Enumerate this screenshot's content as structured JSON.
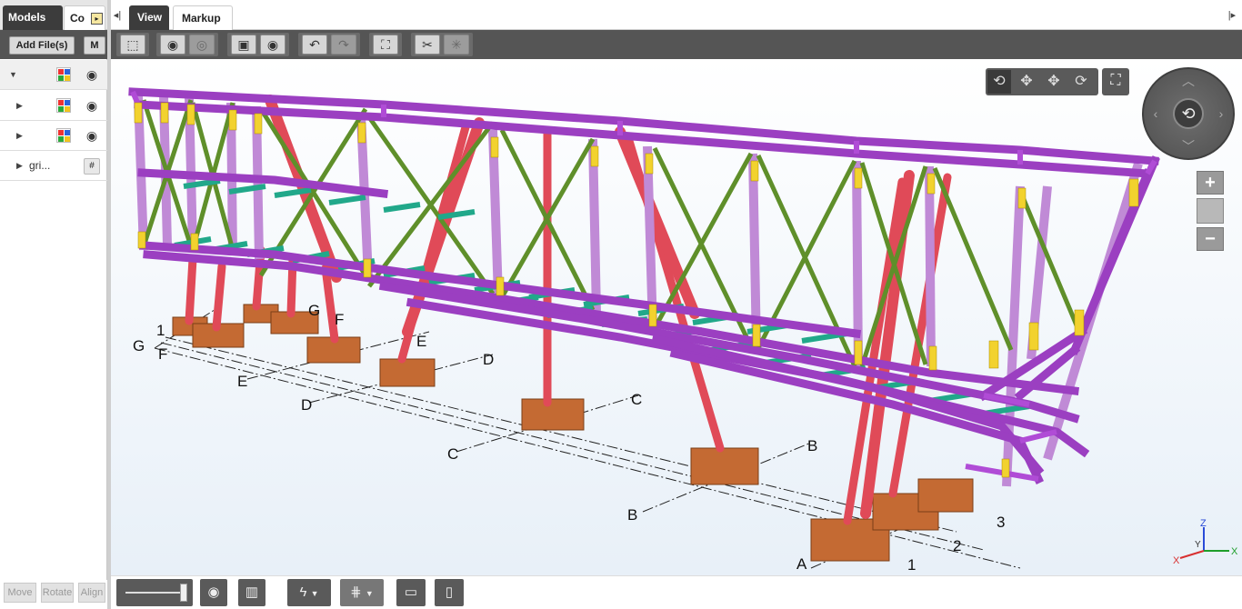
{
  "left_panel": {
    "tabs": [
      "Models",
      "Co"
    ],
    "add_files_label": "Add File(s)",
    "m_label": "M",
    "tree": [
      {
        "label": "",
        "expanded": true
      },
      {
        "label": "",
        "expanded": false
      },
      {
        "label": "",
        "expanded": false
      },
      {
        "label": "gri...",
        "expanded": false
      }
    ],
    "bottom_buttons": [
      "Move",
      "Rotate",
      "Align"
    ]
  },
  "top_tabs": {
    "view": "View",
    "markup": "Markup"
  },
  "toolbar": {
    "buttons": [
      "select-box",
      "visibility-toggle",
      "isolate",
      "snapshot",
      "object-view",
      "undo",
      "redo",
      "fit-view",
      "cut-plane",
      "section-tools"
    ]
  },
  "viewport": {
    "grid_labels": [
      "G",
      "F",
      "E",
      "D",
      "C",
      "B",
      "A",
      "1",
      "2",
      "3"
    ],
    "grid_text": {
      "G_left": "G",
      "F_left": "F",
      "E_left": "E",
      "D_left": "D",
      "C_left": "C",
      "B_left": "B",
      "A_bottom": "A",
      "one_left": "1",
      "G_top": "G",
      "F_top": "F",
      "E_top": "E",
      "D_top": "D",
      "C_top": "C",
      "B_top": "B",
      "one_right": "1",
      "two_right": "2",
      "three_right": "3"
    },
    "axis_triad": {
      "x": "X",
      "y": "Y",
      "z": "Z"
    },
    "colors": {
      "purple_beam": "#9b3fc1",
      "lilac_column": "#c08ad6",
      "red_member": "#e04a58",
      "green_brace": "#5f8f2a",
      "teal_joist": "#21a88a",
      "yellow_plate": "#f2d22e",
      "footing": "#c46a33"
    }
  },
  "bottom_toolbar": {
    "buttons": [
      "transparency-slider",
      "eye",
      "book",
      "lightning",
      "grid-style",
      "comment",
      "document"
    ]
  }
}
